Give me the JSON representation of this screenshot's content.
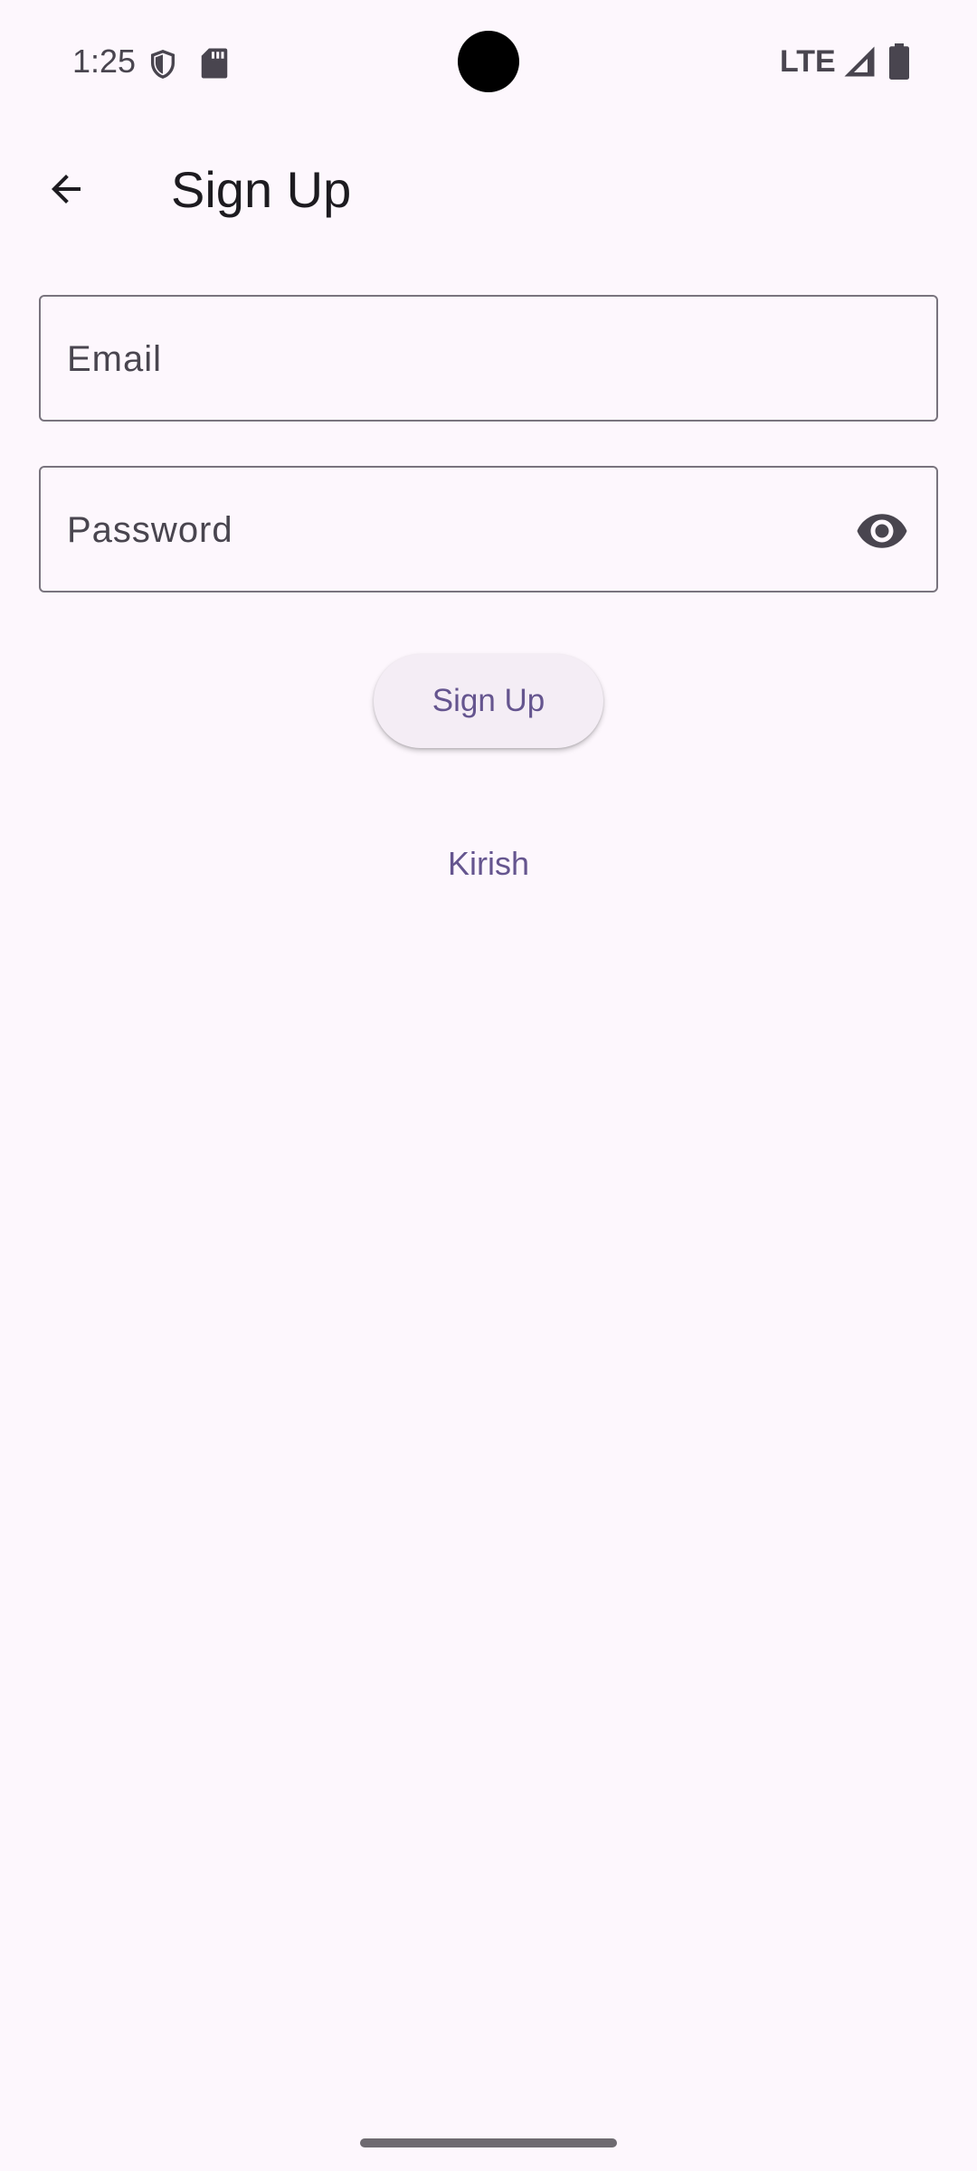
{
  "status_bar": {
    "time": "1:25",
    "network": "LTE",
    "icons": [
      "shield-icon",
      "sd-card-icon",
      "signal-icon",
      "battery-icon"
    ]
  },
  "app_bar": {
    "title": "Sign Up",
    "back_icon": "arrow-back-icon"
  },
  "form": {
    "email_label": "Email",
    "password_label": "Password",
    "password_toggle_icon": "eye-icon",
    "submit_label": "Sign Up",
    "login_link": "Kirish"
  },
  "colors": {
    "background": "#fdf7fd",
    "primary": "#65558f",
    "outline": "#79747e",
    "button_surface": "#f4edf5"
  }
}
